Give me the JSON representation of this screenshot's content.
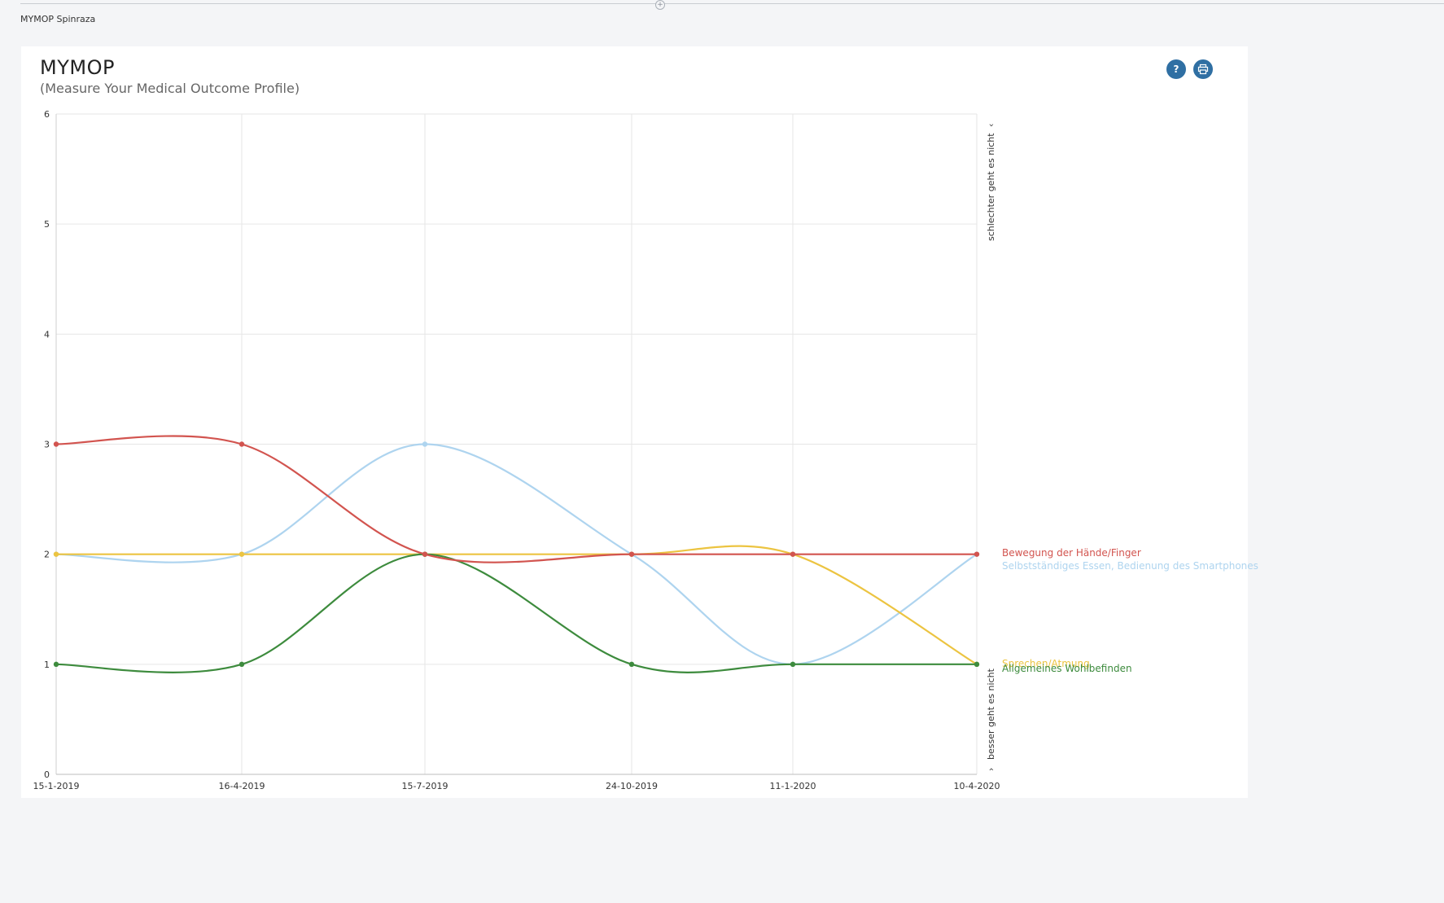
{
  "page": {
    "section_label": "MYMOP Spinraza"
  },
  "card": {
    "title": "MYMOP",
    "subtitle": "(Measure Your Medical Outcome Profile)",
    "help_label": "?",
    "print_icon": "printer-icon"
  },
  "colors": {
    "red": "#d2544f",
    "lightblue": "#aed4ef",
    "yellow": "#ecc441",
    "green": "#3d8b3d"
  },
  "chart_data": {
    "type": "line",
    "x": [
      "15-1-2019",
      "16-4-2019",
      "15-7-2019",
      "24-10-2019",
      "11-1-2020",
      "10-4-2020"
    ],
    "ylim": [
      0,
      6
    ],
    "yticks": [
      0,
      1,
      2,
      3,
      4,
      5,
      6
    ],
    "grid": true,
    "smooth": true,
    "right_axis_top_label": "schlechter geht es nicht",
    "right_axis_bottom_label": "besser geht es nicht",
    "series": [
      {
        "name": "Bewegung der Hände/Finger",
        "color": "#d2544f",
        "values": [
          3,
          3,
          2,
          2,
          2,
          2
        ]
      },
      {
        "name": "Selbstständiges Essen, Bedienung des Smartphones",
        "color": "#aed4ef",
        "values": [
          2,
          2,
          3,
          2,
          1,
          2
        ]
      },
      {
        "name": "Sprechen/Atmung",
        "color": "#ecc441",
        "values": [
          2,
          2,
          2,
          2,
          2,
          1
        ]
      },
      {
        "name": "Allgemeines Wohlbefinden",
        "color": "#3d8b3d",
        "values": [
          1,
          1,
          2,
          1,
          1,
          1
        ]
      }
    ]
  }
}
